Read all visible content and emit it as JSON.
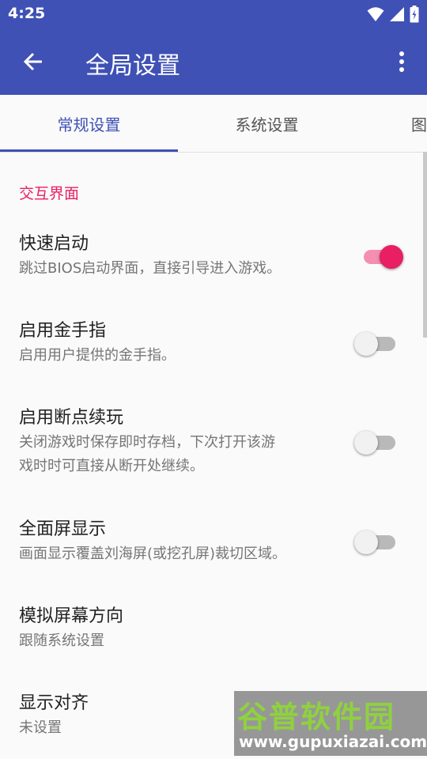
{
  "status_bar": {
    "time": "4:25"
  },
  "app_bar": {
    "title": "全局设置"
  },
  "tabs": [
    {
      "label": "常规设置"
    },
    {
      "label": "系统设置"
    },
    {
      "label": "图"
    }
  ],
  "category": "交互界面",
  "prefs": [
    {
      "title": "快速启动",
      "summary": "跳过BIOS启动界面，直接引导进入游戏。",
      "switch_on": true
    },
    {
      "title": "启用金手指",
      "summary": "启用用户提供的金手指。",
      "switch_on": false
    },
    {
      "title": "启用断点续玩",
      "summary_line1": "关闭游戏时保存即时存档，下次打开该游",
      "summary_line2": "戏时时可直接从断开处继续。",
      "switch_on": false
    },
    {
      "title": "全面屏显示",
      "summary": "画面显示覆盖刘海屏(或挖孔屏)裁切区域。",
      "switch_on": false
    },
    {
      "title": "模拟屏幕方向",
      "summary": "跟随系统设置"
    },
    {
      "title": "显示对齐",
      "summary": "未设置"
    }
  ],
  "watermark": {
    "main": "谷普软件园",
    "url": "www.gupuxiazai.com"
  },
  "colors": {
    "primary": "#3f51b5",
    "accent": "#e91e63"
  },
  "icons": [
    "wifi-icon",
    "signal-icon",
    "battery-icon",
    "back-arrow-icon",
    "more-vert-icon"
  ]
}
